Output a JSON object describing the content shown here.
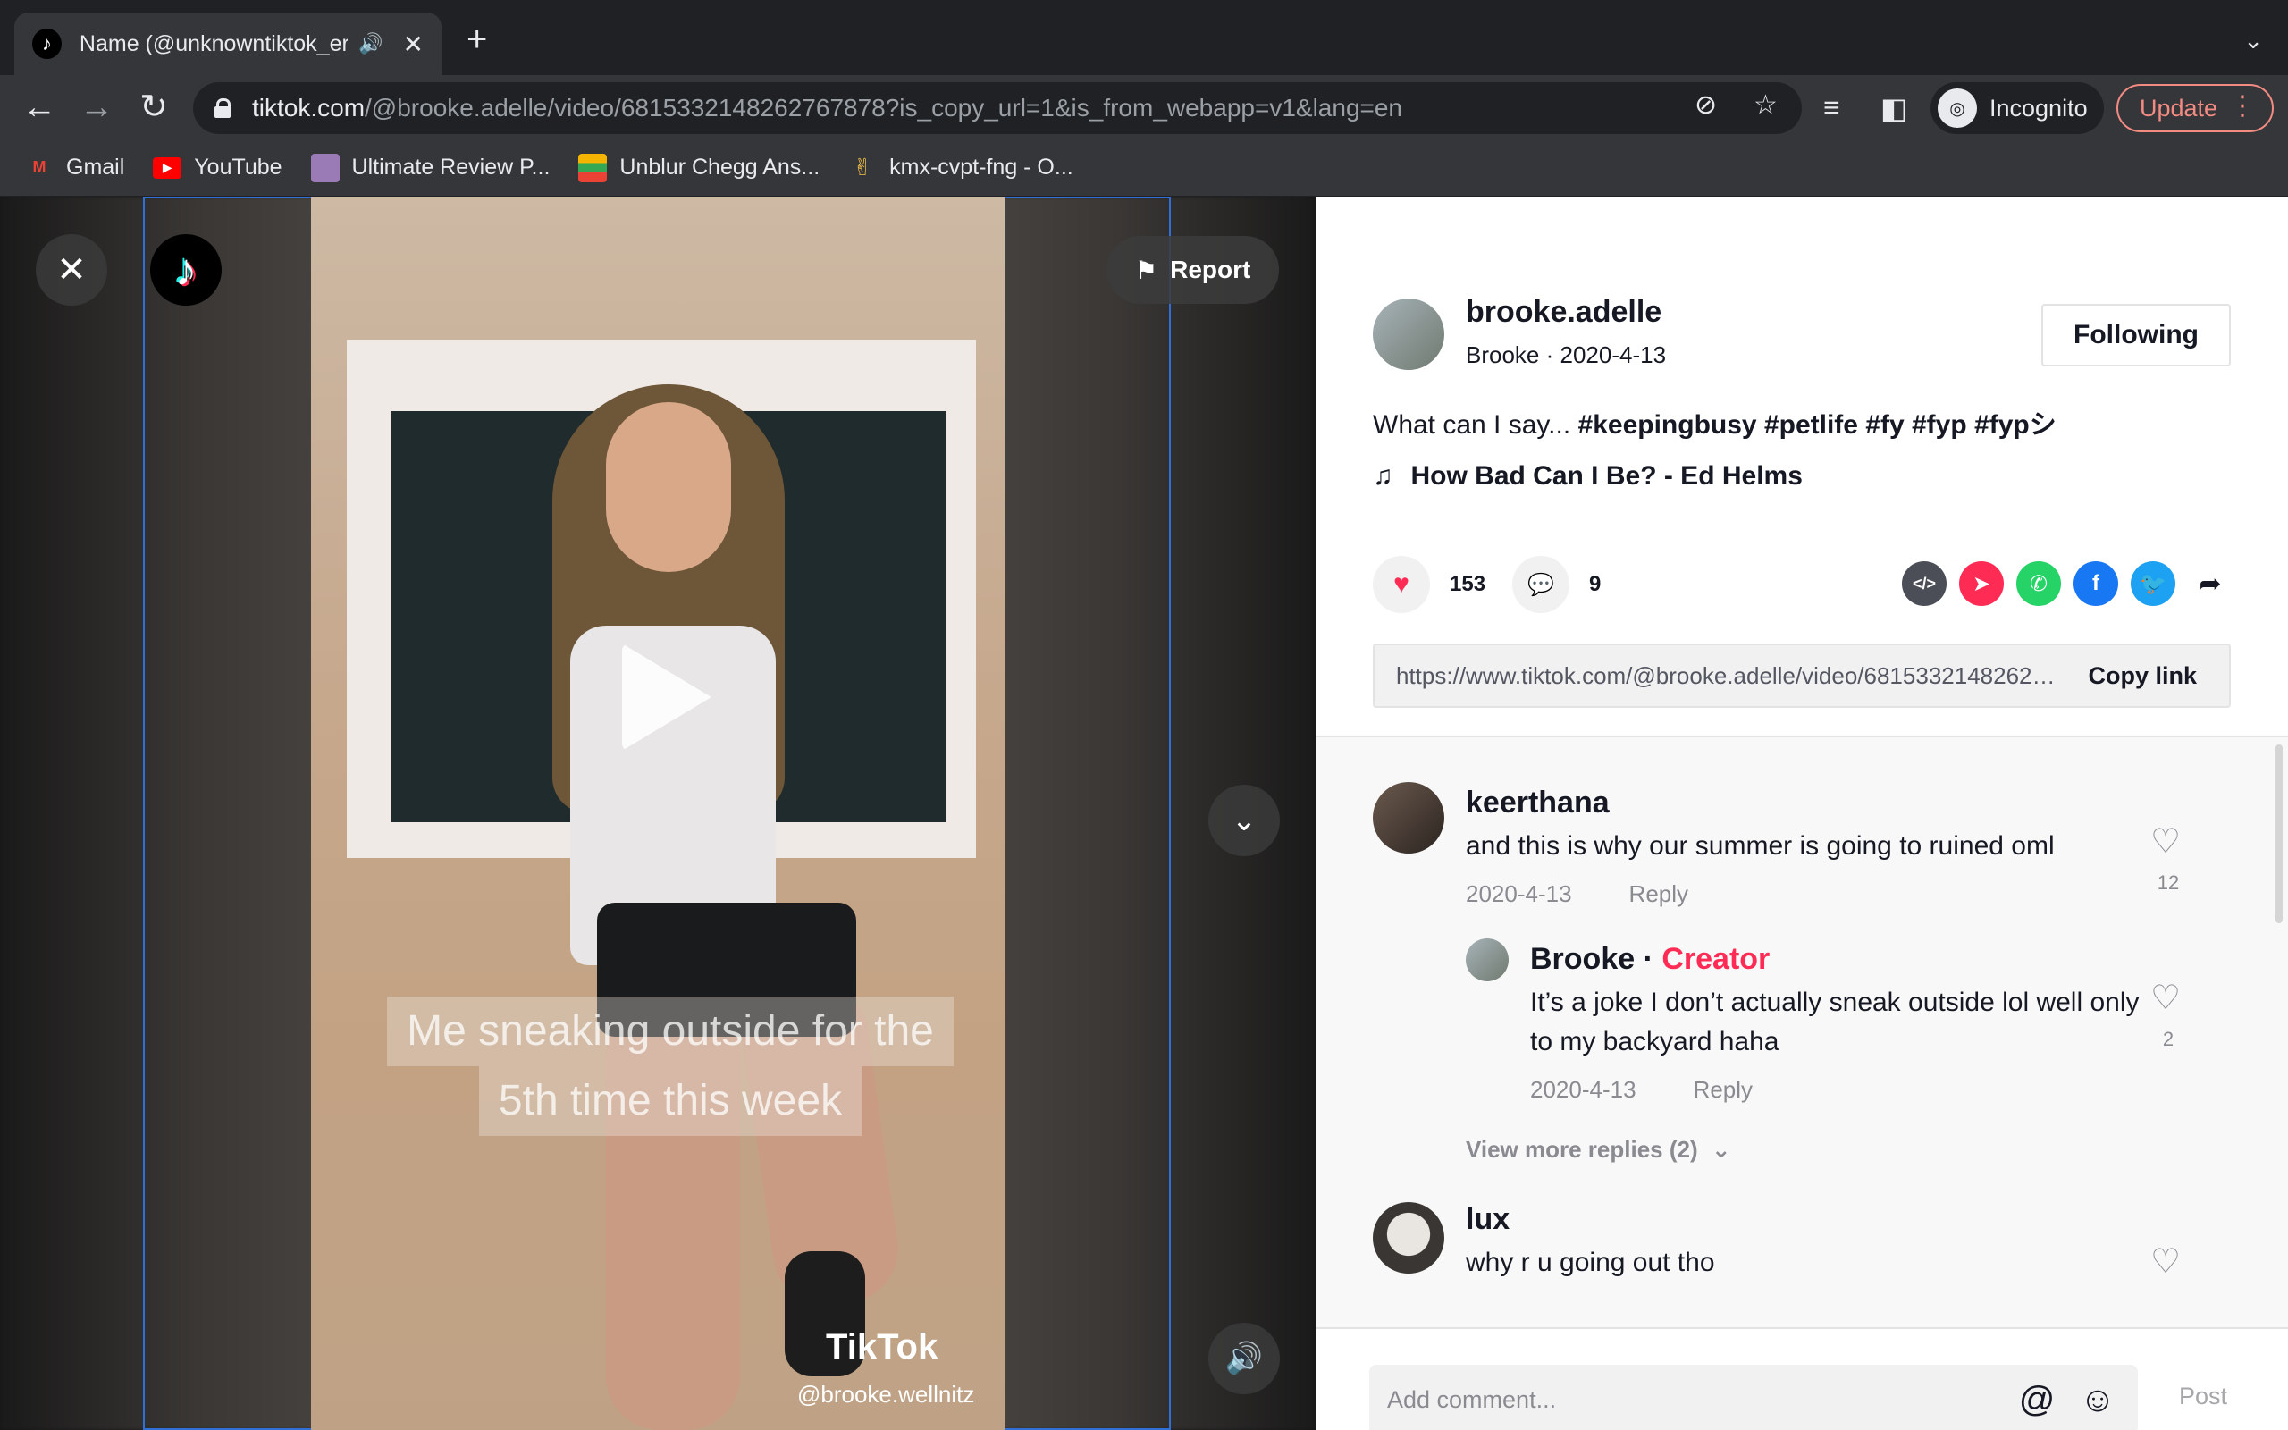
{
  "browser": {
    "tab_title": "Name (@unknowntiktok_er",
    "tab_audio_icon": "speaker-icon",
    "new_tab": "+",
    "url_host": "tiktok.com",
    "url_path": "/@brooke.adelle/video/6815332148262767878?is_copy_url=1&is_from_webapp=v1&lang=en",
    "incognito_label": "Incognito",
    "update_label": "Update",
    "bookmarks": [
      {
        "label": "Gmail",
        "icon": "gmail-icon",
        "color": "#ea4335"
      },
      {
        "label": "YouTube",
        "icon": "youtube-icon",
        "color": "#ff0000"
      },
      {
        "label": "Ultimate Review P...",
        "icon": "avatar-icon",
        "color": "#9b7bb5"
      },
      {
        "label": "Unblur Chegg Ans...",
        "icon": "books-icon",
        "color": "#f4b400"
      },
      {
        "label": "kmx-cvpt-fng - O...",
        "icon": "hand-icon",
        "color": "#f5c04a"
      }
    ]
  },
  "video": {
    "report_label": "Report",
    "caption_line1": "Me sneaking outside for the",
    "caption_line2": "5th time this week",
    "watermark_logo": "TikTok",
    "watermark_user": "@brooke.wellnitz"
  },
  "post": {
    "username": "brooke.adelle",
    "display_name": "Brooke",
    "date": "2020-4-13",
    "follow_label": "Following",
    "description_plain": "What can I say... ",
    "description_tags": "#keepingbusy #petlife #fy #fyp #fypシ",
    "music": "How Bad Can I Be? - Ed Helms",
    "likes": "153",
    "comments_count": "9",
    "link_url": "https://www.tiktok.com/@brooke.adelle/video/6815332148262767878?is_copy_url=1&is_from_webapp=v1&lang=en",
    "copy_link_label": "Copy link",
    "share_colors": {
      "embed": "#4b4e57",
      "send": "#fe2c55",
      "whatsapp": "#25d366",
      "facebook": "#1877f2",
      "twitter": "#1da1f2"
    }
  },
  "comments": [
    {
      "user": "keerthana",
      "text": "and this is why our summer is going to ruined oml",
      "date": "2020-4-13",
      "reply": "Reply",
      "likes": "12"
    },
    {
      "user": "Brooke",
      "badge": "Creator",
      "text": "It’s a joke I don’t actually sneak outside lol well only to my backyard haha",
      "date": "2020-4-13",
      "reply": "Reply",
      "likes": "2"
    },
    {
      "user": "lux",
      "text": "why r u going out tho"
    }
  ],
  "view_more_replies": "View more replies (2)",
  "composer": {
    "placeholder": "Add comment...",
    "post_label": "Post"
  }
}
